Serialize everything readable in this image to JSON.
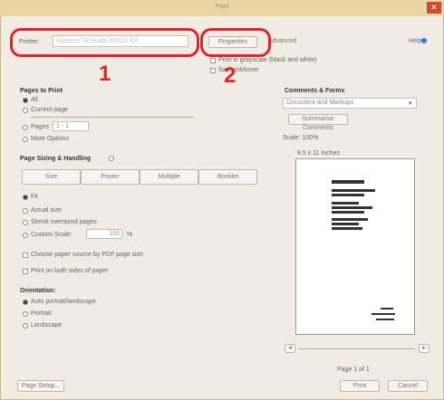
{
  "window": {
    "title": "Print",
    "close_glyph": "✕"
  },
  "top": {
    "printer_label": "Printer:",
    "printer_value": "Kyocera TASKalfa 5052ci KX",
    "properties_label": "Properties",
    "advanced_label": "Advanced",
    "help_label": "Help",
    "option1": "Print in grayscale (black and white)",
    "option2": "Save ink/toner"
  },
  "callouts": {
    "one": "1",
    "two": "2"
  },
  "pages": {
    "title": "Pages to Print",
    "all": "All",
    "current": "Current page",
    "pages_label": "Pages",
    "pages_value": "1 - 1",
    "more": "More Options"
  },
  "sizing": {
    "title": "Page Sizing & Handling",
    "tabs": [
      "Size",
      "Poster",
      "Multiple",
      "Booklet"
    ],
    "fit": "Fit",
    "actual": "Actual size",
    "shrink": "Shrink oversized pages",
    "custom_label": "Custom Scale:",
    "custom_value": "100",
    "custom_unit": "%",
    "paper_source": "Choose paper source by PDF page size",
    "print_both": "Print on both sides of paper"
  },
  "orientation": {
    "title": "Orientation:",
    "auto": "Auto portrait/landscape",
    "portrait": "Portrait",
    "landscape": "Landscape"
  },
  "comments": {
    "title": "Comments & Forms",
    "value": "Document and Markups",
    "summarize": "Summarize Comments"
  },
  "preview": {
    "scale": "Scale: 100%",
    "size": "8.5 x 11 Inches",
    "page_label": "Page 1 of 1"
  },
  "footer": {
    "page_setup": "Page Setup...",
    "print": "Print",
    "cancel": "Cancel"
  },
  "colors": {
    "callout": "#e2232e",
    "titlebar": "#e8d7a2",
    "close": "#cf4a2e"
  }
}
